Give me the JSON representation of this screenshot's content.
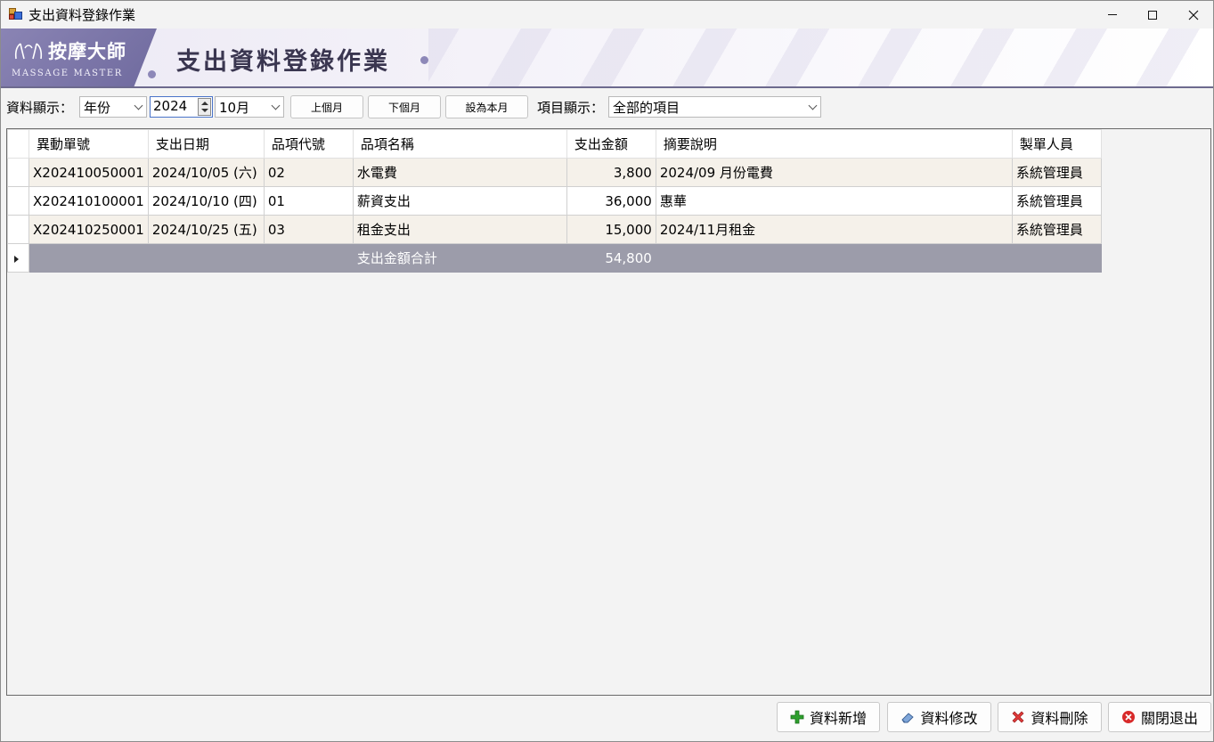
{
  "window": {
    "title": "支出資料登錄作業"
  },
  "banner": {
    "logo_cn": "按摩大師",
    "logo_en": "MASSAGE MASTER",
    "title": "支出資料登錄作業",
    "colors": {
      "accent": "#7a75aa",
      "title": "#3a3650"
    }
  },
  "toolbar": {
    "display_label": "資料顯示：",
    "mode_value": "年份",
    "year_value": "2024",
    "month_value": "10月",
    "prev_month_label": "上個月",
    "next_month_label": "下個月",
    "this_month_label": "設為本月",
    "item_label": "項目顯示：",
    "item_value": "全部的項目"
  },
  "grid": {
    "columns": [
      "異動單號",
      "支出日期",
      "品項代號",
      "品項名稱",
      "支出金額",
      "摘要說明",
      "製單人員"
    ],
    "rows": [
      [
        "X202410050001",
        "2024/10/05 (六)",
        "02",
        "水電費",
        "3,800",
        "2024/09 月份電費",
        "系統管理員"
      ],
      [
        "X202410100001",
        "2024/10/10 (四)",
        "01",
        "薪資支出",
        "36,000",
        "惠華",
        "系統管理員"
      ],
      [
        "X202410250001",
        "2024/10/25 (五)",
        "03",
        "租金支出",
        "15,000",
        "2024/11月租金",
        "系統管理員"
      ]
    ],
    "total_label": "支出金額合計",
    "total_value": "54,800"
  },
  "actions": {
    "add_label": "資料新增",
    "edit_label": "資料修改",
    "delete_label": "資料刪除",
    "exit_label": "關閉退出"
  },
  "icons": {
    "add": "plus-icon",
    "edit": "eraser-icon",
    "delete": "x-icon",
    "exit": "close-circle-icon"
  }
}
